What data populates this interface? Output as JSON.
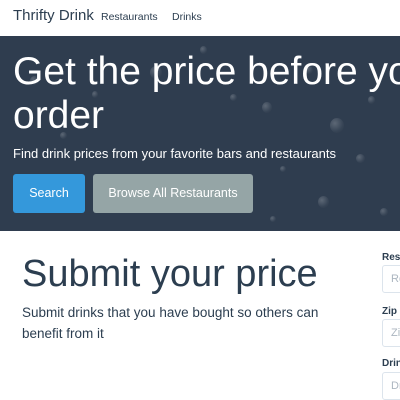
{
  "navbar": {
    "brand": "Thrifty Drink",
    "links": [
      "Restaurants",
      "Drinks"
    ]
  },
  "hero": {
    "title": "Get the price before you order",
    "subtitle": "Find drink prices from your favorite bars and restaurants",
    "search_button": "Search",
    "browse_button": "Browse All Restaurants"
  },
  "submit": {
    "title": "Submit your price",
    "description": "Submit drinks that you have bought so others can benefit from it"
  },
  "form": {
    "restaurant_label": "Restaurant",
    "restaurant_placeholder": "Restaurant",
    "zip_label": "Zip Code",
    "zip_placeholder": "Zip Code",
    "drink_label": "Drink",
    "drink_placeholder": "Drink"
  },
  "colors": {
    "primary": "#2c3e50",
    "accent": "#3498db",
    "muted": "#95a5a6"
  }
}
